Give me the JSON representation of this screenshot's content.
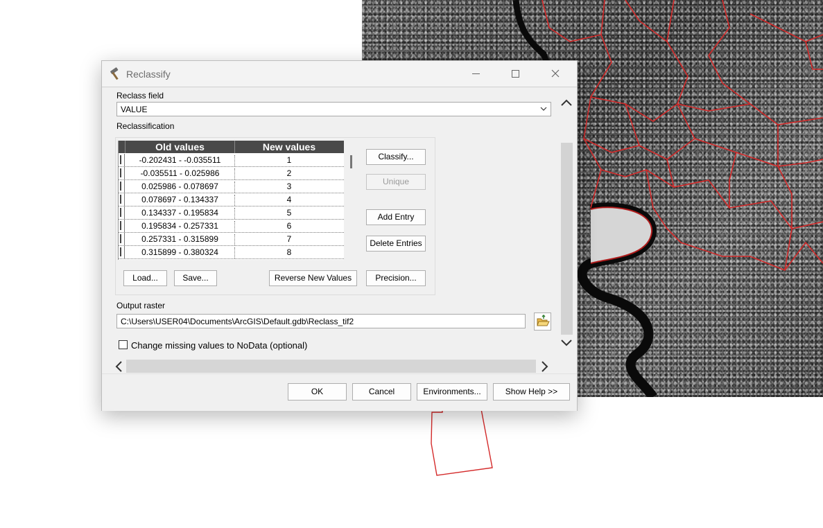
{
  "window": {
    "title": "Reclassify",
    "icon": "hammer-icon",
    "controls": [
      "minimize-icon",
      "maximize-icon",
      "close-icon"
    ]
  },
  "reclass_field": {
    "label": "Reclass field",
    "value": "VALUE"
  },
  "reclassification": {
    "label": "Reclassification",
    "columns": [
      "Old values",
      "New values"
    ],
    "rows": [
      {
        "old": "-0.202431 - -0.035511",
        "new": "1"
      },
      {
        "old": "-0.035511 - 0.025986",
        "new": "2"
      },
      {
        "old": "0.025986 - 0.078697",
        "new": "3"
      },
      {
        "old": "0.078697 - 0.134337",
        "new": "4"
      },
      {
        "old": "0.134337 - 0.195834",
        "new": "5"
      },
      {
        "old": "0.195834 - 0.257331",
        "new": "6"
      },
      {
        "old": "0.257331 - 0.315899",
        "new": "7"
      },
      {
        "old": "0.315899 - 0.380324",
        "new": "8"
      }
    ],
    "buttons": {
      "classify": "Classify...",
      "unique": "Unique",
      "add_entry": "Add Entry",
      "delete_entries": "Delete Entries",
      "load": "Load...",
      "save": "Save...",
      "reverse": "Reverse New Values",
      "precision": "Precision..."
    }
  },
  "output_raster": {
    "label": "Output raster",
    "value": "C:\\Users\\USER04\\Documents\\ArcGIS\\Default.gdb\\Reclass_tif2"
  },
  "nodata": {
    "label": "Change missing values to NoData (optional)",
    "checked": false
  },
  "footer": {
    "ok": "OK",
    "cancel": "Cancel",
    "environments": "Environments...",
    "show_help": "Show Help >>"
  },
  "colors": {
    "boundary_lines": "#d42a2a",
    "table_header": "#494949"
  }
}
